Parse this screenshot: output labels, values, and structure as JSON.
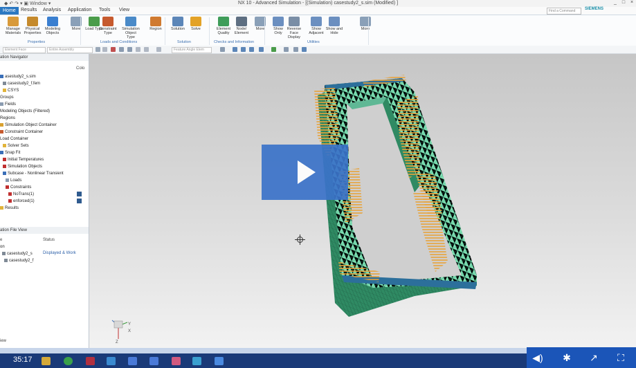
{
  "window": {
    "title": "NX 10 - Advanced Simulation - [(Simulation) casestudy2_s.sim (Modified) ]",
    "quick_access_menu": "Window",
    "controls": [
      "_",
      "□",
      "×"
    ]
  },
  "menu": {
    "tabs": [
      "Home",
      "Results",
      "Analysis",
      "Application",
      "Tools",
      "View"
    ],
    "active_tab": "Home",
    "find_placeholder": "Find a Command",
    "brand": "SIEMENS"
  },
  "ribbon": {
    "commands": [
      {
        "label": "Manage Materials",
        "icon": "materials-icon",
        "color": "#d89a3a"
      },
      {
        "label": "Physical Properties",
        "icon": "physical-properties-icon",
        "color": "#c58a2c"
      },
      {
        "label": "Modeling Objects",
        "icon": "modeling-objects-icon",
        "color": "#3a7fd0"
      },
      {
        "label": "More",
        "icon": "more-icon",
        "color": "#8aa0b8"
      },
      {
        "label": "Load Type",
        "icon": "load-type-icon",
        "color": "#4a9c4a"
      },
      {
        "label": "Constraint Type",
        "icon": "constraint-type-icon",
        "color": "#c65a2e"
      },
      {
        "label": "Simulation Object Type",
        "icon": "simulation-object-icon",
        "color": "#4a8ac8"
      },
      {
        "label": "Region",
        "icon": "region-icon",
        "color": "#d07a30"
      },
      {
        "label": "Solution",
        "icon": "solution-icon",
        "color": "#5c86b8"
      },
      {
        "label": "Solve",
        "icon": "solve-icon",
        "color": "#e3a227"
      },
      {
        "label": "Element Quality",
        "icon": "element-quality-icon",
        "color": "#3f9d5a"
      },
      {
        "label": "Node/ Element",
        "icon": "node-element-icon",
        "color": "#5e6f82"
      },
      {
        "label": "More",
        "icon": "more-icon",
        "color": "#8aa0b8"
      },
      {
        "label": "Show Only",
        "icon": "show-only-icon",
        "color": "#6b8fc0"
      },
      {
        "label": "Reverse Face Display",
        "icon": "reverse-face-icon",
        "color": "#7a8ea6"
      },
      {
        "label": "Show Adjacent",
        "icon": "show-adjacent-icon",
        "color": "#6b8fc0"
      },
      {
        "label": "Show and Hide",
        "icon": "show-hide-icon",
        "color": "#6b8fc0"
      },
      {
        "label": "More",
        "icon": "more-icon",
        "color": "#8aa0b8"
      }
    ],
    "groups": [
      "Properties",
      "Loads and Conditions",
      "Solution",
      "Checks and Information",
      "Utilities"
    ]
  },
  "filters": {
    "face": "Element Face",
    "assembly": "Entire Assembly",
    "angle": "Feature Angle Elem"
  },
  "navigator": {
    "title": "ation Navigator",
    "column": "Colo",
    "rows": [
      {
        "label": "asestudy2_s.sim",
        "indent": 0,
        "icon_color": "#3a6fb8"
      },
      {
        "label": "casestudy2_f.fem",
        "indent": 1,
        "icon_color": "#7f8a96"
      },
      {
        "label": "CSYS",
        "indent": 1,
        "icon_color": "#e1b43a"
      },
      {
        "label": "Groups",
        "indent": 0,
        "icon_color": ""
      },
      {
        "label": "Fields",
        "indent": 0,
        "icon_color": "#8a9bb0"
      },
      {
        "label": "Modeling Objects (Filtered)",
        "indent": 0,
        "icon_color": ""
      },
      {
        "label": "Regions",
        "indent": 0,
        "icon_color": ""
      },
      {
        "label": "Simulation Object Container",
        "indent": 0,
        "icon_color": "#d9a130"
      },
      {
        "label": "Constraint Container",
        "indent": 0,
        "icon_color": "#c65a2e"
      },
      {
        "label": "Load Container",
        "indent": 0,
        "icon_color": ""
      },
      {
        "label": "Solver Sets",
        "indent": 1,
        "icon_color": "#e1b43a"
      },
      {
        "label": "Snap Fit",
        "indent": 0,
        "icon_color": "#3a6fb8"
      },
      {
        "label": "Initial Temperatures",
        "indent": 1,
        "icon_color": "#c03030"
      },
      {
        "label": "Simulation Objects",
        "indent": 1,
        "icon_color": "#c03030"
      },
      {
        "label": "Subcase - Nonlinear Transient",
        "indent": 1,
        "icon_color": "#3a6fb8"
      },
      {
        "label": "Loads",
        "indent": 2,
        "icon_color": "#8a9bb0"
      },
      {
        "label": "Constraints",
        "indent": 2,
        "icon_color": "#c03030"
      },
      {
        "label": "NoTrans(1)",
        "indent": 3,
        "icon_color": "#c03030",
        "swatch": true
      },
      {
        "label": "enforced(1)",
        "indent": 3,
        "icon_color": "#c03030",
        "swatch": true
      },
      {
        "label": "Results",
        "indent": 0,
        "icon_color": "#e1b43a"
      }
    ]
  },
  "file_view": {
    "title": "ation File View",
    "col_name": "e",
    "col_status": "Status",
    "rows": [
      {
        "name": "on",
        "status": ""
      },
      {
        "name": "casestudy2_s",
        "status": "Displayed & Work"
      },
      {
        "name": "casestudy2_f",
        "status": ""
      }
    ],
    "footer": "iew"
  },
  "viewport": {
    "background_top": "#c6c6c6",
    "background_bottom": "#f2f2f2",
    "mesh_color": "#7fe0b3",
    "mesh_line_color": "#3c9c7a",
    "load_color": "#e8a23a",
    "axis_labels": [
      "Y",
      "X",
      "Z"
    ]
  },
  "video": {
    "time": "35:17",
    "controls": [
      "volume-icon",
      "settings-icon",
      "share-icon",
      "fullscreen-icon"
    ]
  }
}
